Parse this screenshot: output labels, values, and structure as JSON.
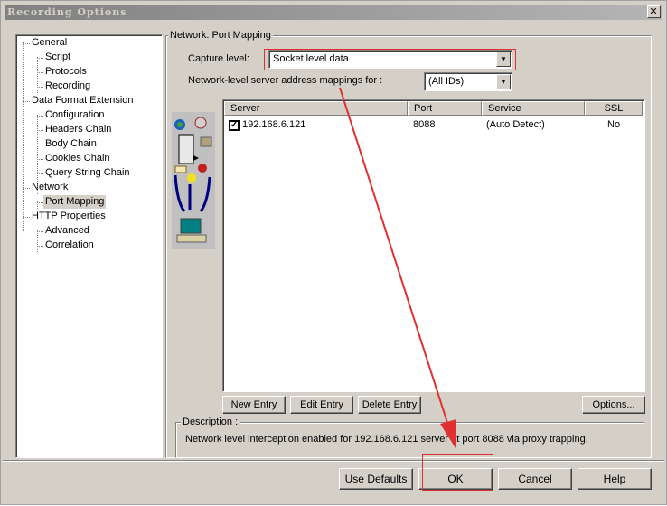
{
  "window": {
    "title": "Recording Options",
    "close": "✕"
  },
  "tree": [
    {
      "label": "General",
      "level": 0
    },
    {
      "label": "Script",
      "level": 1
    },
    {
      "label": "Protocols",
      "level": 1
    },
    {
      "label": "Recording",
      "level": 1
    },
    {
      "label": "Data Format Extension",
      "level": 0
    },
    {
      "label": "Configuration",
      "level": 1
    },
    {
      "label": "Headers Chain",
      "level": 1
    },
    {
      "label": "Body Chain",
      "level": 1
    },
    {
      "label": "Cookies Chain",
      "level": 1
    },
    {
      "label": "Query String Chain",
      "level": 1
    },
    {
      "label": "Network",
      "level": 0
    },
    {
      "label": "Port Mapping",
      "level": 1,
      "selected": true
    },
    {
      "label": "HTTP Properties",
      "level": 0
    },
    {
      "label": "Advanced",
      "level": 1
    },
    {
      "label": "Correlation",
      "level": 1
    }
  ],
  "panel": {
    "title": "Network: Port Mapping",
    "capture_label": "Capture level:",
    "capture_value": "Socket level data",
    "mapping_label": "Network-level server address mappings for :",
    "mapping_value": "(All IDs)",
    "columns": [
      "Server",
      "Port",
      "Service",
      "SSL"
    ],
    "rows": [
      {
        "checked": true,
        "server": "192.168.6.121",
        "port": "8088",
        "service": "(Auto Detect)",
        "ssl": "No"
      }
    ],
    "new_entry": "New Entry",
    "edit_entry": "Edit Entry",
    "delete_entry": "Delete Entry",
    "options": "Options...",
    "description_label": "Description :",
    "description": "Network level interception enabled for 192.168.6.121 server at port 8088 via proxy trapping."
  },
  "footer": {
    "use_defaults": "Use Defaults",
    "ok": "OK",
    "cancel": "Cancel",
    "help": "Help"
  },
  "annotation_color": "#e03030"
}
